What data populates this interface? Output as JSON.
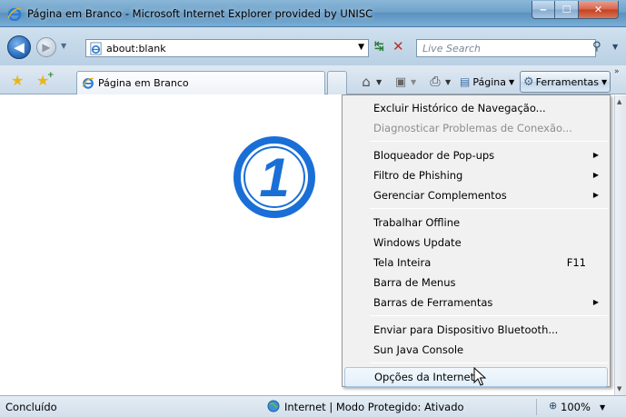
{
  "window": {
    "title": "Página em Branco - Microsoft Internet Explorer provided by UNISC"
  },
  "navigation": {
    "address": "about:blank",
    "search_placeholder": "Live Search"
  },
  "tab": {
    "label": "Página em Branco"
  },
  "command_bar": {
    "page_label": "Página",
    "tools_label": "Ferramentas"
  },
  "callout": {
    "number": "1"
  },
  "tools_menu": {
    "groups": [
      [
        {
          "label": "Excluir Histórico de Navegação...",
          "enabled": true
        },
        {
          "label": "Diagnosticar Problemas de Conexão...",
          "enabled": false
        }
      ],
      [
        {
          "label": "Bloqueador de Pop-ups",
          "submenu": true
        },
        {
          "label": "Filtro de Phishing",
          "submenu": true
        },
        {
          "label": "Gerenciar Complementos",
          "submenu": true
        }
      ],
      [
        {
          "label": "Trabalhar Offline"
        },
        {
          "label": "Windows Update"
        },
        {
          "label": "Tela Inteira",
          "shortcut": "F11"
        },
        {
          "label": "Barra de Menus"
        },
        {
          "label": "Barras de Ferramentas",
          "submenu": true
        }
      ],
      [
        {
          "label": "Enviar para Dispositivo Bluetooth..."
        },
        {
          "label": "Sun Java Console"
        }
      ],
      [
        {
          "label": "Opções da Internet",
          "highlighted": true
        }
      ]
    ]
  },
  "status_bar": {
    "status": "Concluído",
    "zone": "Internet | Modo Protegido: Ativado",
    "zoom": "100%"
  },
  "colors": {
    "callout_blue": "#1a6fd6",
    "title_bar": "#6fa3cb",
    "close_button": "#c4401f"
  }
}
